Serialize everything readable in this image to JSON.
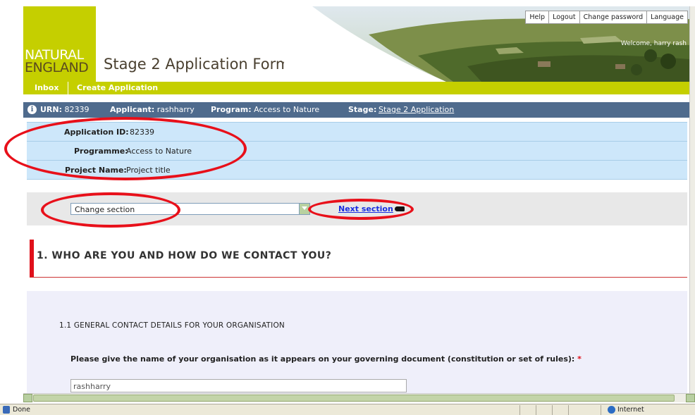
{
  "brand": {
    "line1": "NATURAL",
    "line2": "ENGLAND"
  },
  "header": {
    "title": "Stage 2 Application Form",
    "topnav": [
      "Help",
      "Logout",
      "Change password",
      "Language"
    ],
    "welcome": "Welcome, harry rash"
  },
  "menu": {
    "items": [
      "Inbox",
      "Create Application"
    ]
  },
  "infobar": {
    "urn_label": "URN:",
    "urn_value": "82339",
    "applicant_label": "Applicant:",
    "applicant_value": "rashharry",
    "program_label": "Program:",
    "program_value": "Access to Nature",
    "stage_label": "Stage:",
    "stage_value": "Stage 2 Application"
  },
  "details": {
    "application_id_label": "Application ID:",
    "application_id_value": "82339",
    "programme_label": "Programme:",
    "programme_value": "Access to Nature",
    "project_name_label": "Project Name:",
    "project_name_value": "Project title"
  },
  "chooser": {
    "select_value": "Change section",
    "next_link": "Next section"
  },
  "section": {
    "title": "1. WHO ARE YOU AND HOW DO WE CONTACT YOU?",
    "subheading": "1.1  GENERAL CONTACT DETAILS FOR YOUR ORGANISATION",
    "question": "Please give the name of your organisation as it appears on your governing document (constitution or set of rules):",
    "required_mark": "*",
    "org_name_value": "rashharry"
  },
  "statusbar": {
    "status": "Done",
    "zone": "Internet"
  },
  "colors": {
    "brand_green": "#c5cf00",
    "info_bar": "#4f6b8d",
    "details_bg": "#cde7fa",
    "annotation_red": "#e8101a",
    "link_blue": "#1a2ee0"
  },
  "icons": [
    "info-icon",
    "dropdown-arrow-icon",
    "hand-pointer-icon",
    "page-icon",
    "globe-icon"
  ]
}
